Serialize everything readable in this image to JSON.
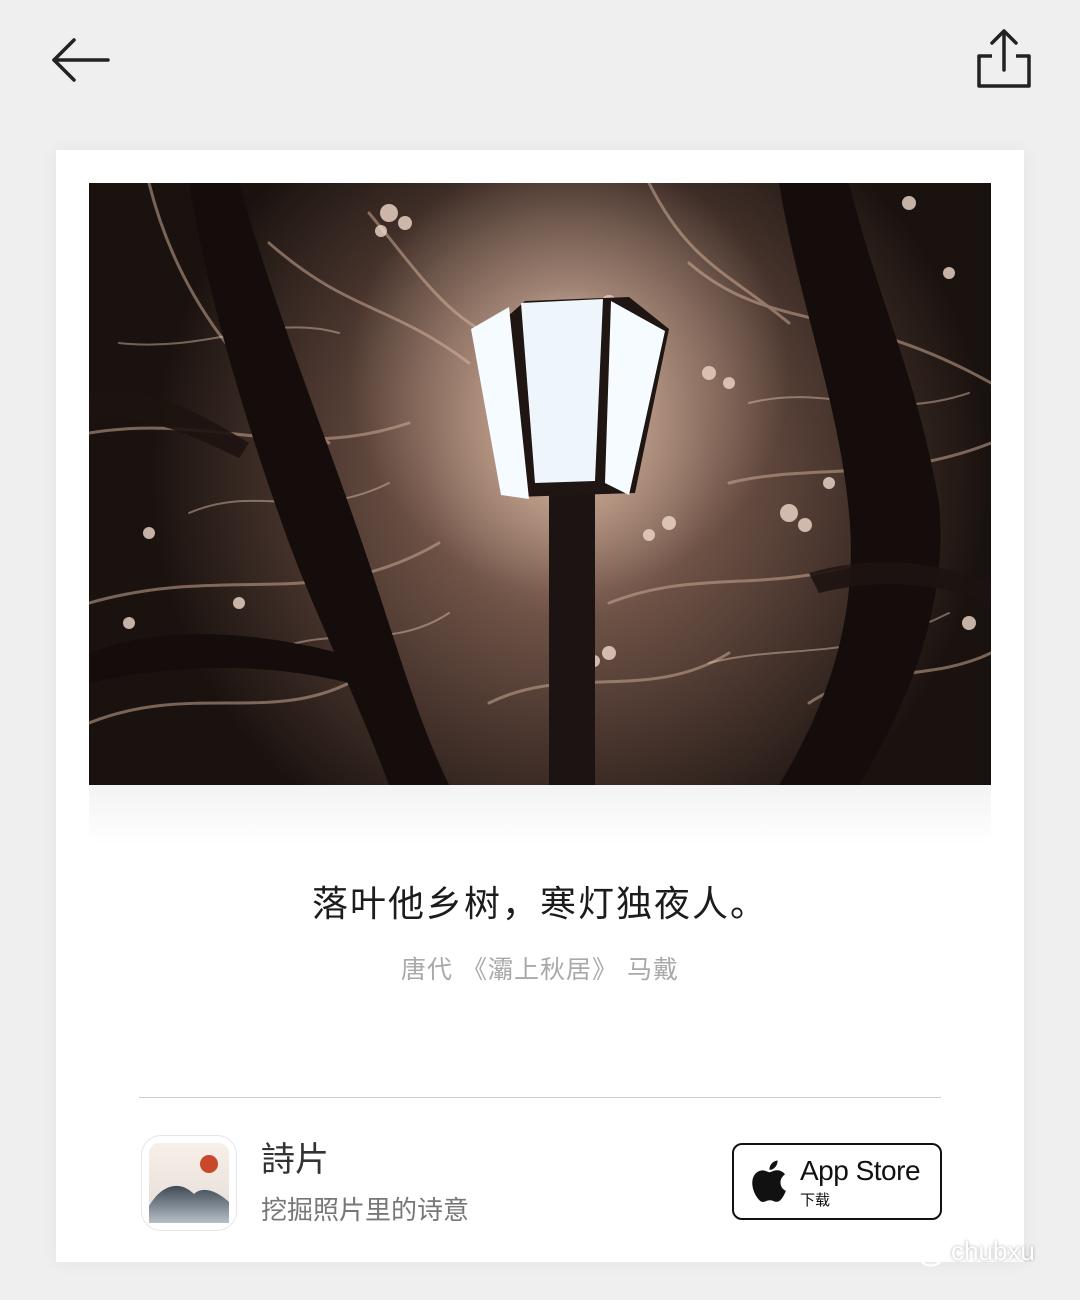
{
  "card": {
    "quote": "落叶他乡树，寒灯独夜人。",
    "source": "唐代 《灞上秋居》 马戴"
  },
  "app": {
    "name": "詩片",
    "tagline": "挖掘照片里的诗意",
    "store_title": "App Store",
    "store_sub": "下载"
  },
  "watermark": {
    "text": "chubxu"
  },
  "icons": {
    "back": "arrow-left-icon",
    "share": "share-icon",
    "apple": "apple-icon",
    "wechat": "wechat-icon"
  },
  "colors": {
    "background": "#efefef",
    "card": "#ffffff",
    "quote": "#1c1c1c",
    "source": "#a9a9a9",
    "app_icon_dot": "#c9472a"
  }
}
